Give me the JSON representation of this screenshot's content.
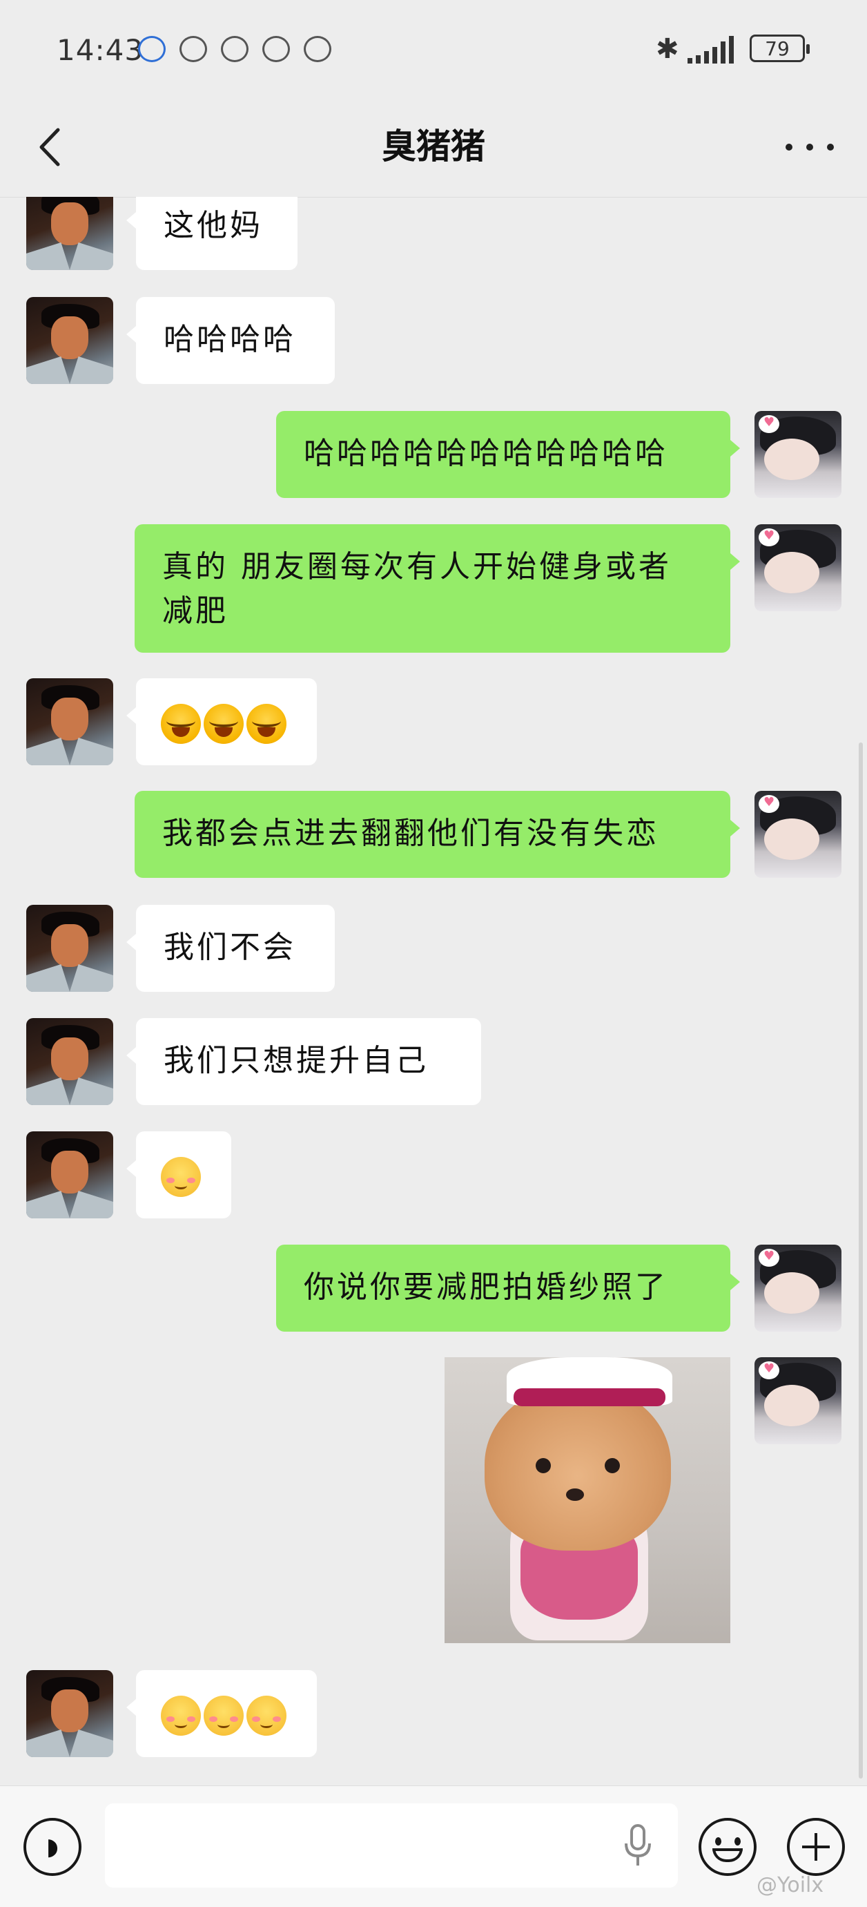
{
  "status_bar": {
    "time": "14:43",
    "battery": "79"
  },
  "header": {
    "title": "臭猪猪"
  },
  "messages": [
    {
      "side": "in",
      "text": "这他妈"
    },
    {
      "side": "in",
      "text": "哈哈哈哈"
    },
    {
      "side": "out",
      "text": "哈哈哈哈哈哈哈哈哈哈哈"
    },
    {
      "side": "out",
      "text": "真的 朋友圈每次有人开始健身或者减肥"
    },
    {
      "side": "in",
      "emoji": [
        "laughing-crying",
        "laughing-crying",
        "laughing-crying"
      ]
    },
    {
      "side": "out",
      "text": "我都会点进去翻翻他们有没有失恋"
    },
    {
      "side": "in",
      "text": "我们不会"
    },
    {
      "side": "in",
      "text": "我们只想提升自己"
    },
    {
      "side": "in",
      "emoji": [
        "blush"
      ]
    },
    {
      "side": "out",
      "text": "你说你要减肥拍婚纱照了"
    },
    {
      "side": "out",
      "sticker": "puppy-chef-sticker"
    },
    {
      "side": "in",
      "emoji": [
        "blush",
        "blush",
        "blush"
      ]
    }
  ],
  "input_bar": {
    "value": ""
  },
  "watermark": "@Yoilx",
  "colors": {
    "background": "#ededed",
    "outgoing_bubble": "#95ec69",
    "incoming_bubble": "#ffffff"
  }
}
